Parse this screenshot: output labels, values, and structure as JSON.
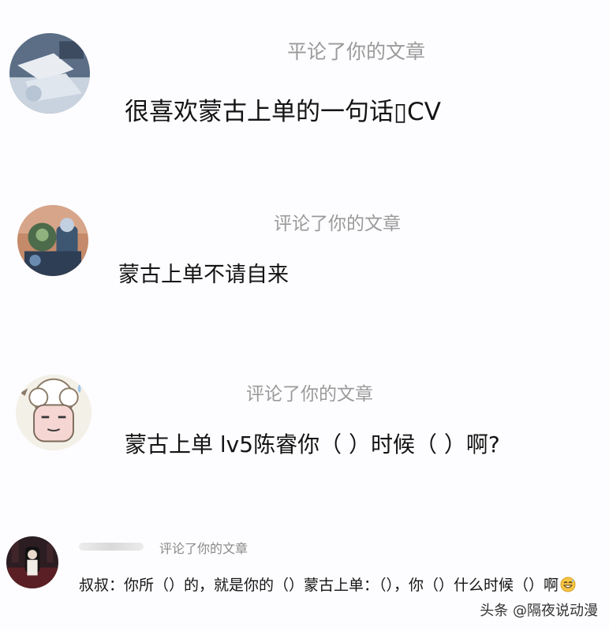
{
  "notifications": [
    {
      "action": "平论了你的文章",
      "comment": "很喜欢蒙古上单的一句话▯CV"
    },
    {
      "action": "评论了你的文章",
      "comment": "蒙古上单不请自来"
    },
    {
      "action": "评论了你的文章",
      "comment": "蒙古上单 lv5陈睿你（ ）时候（ ）啊?"
    },
    {
      "action": "评论了你的文章",
      "comment": "叔叔：你所（）的，就是你的（）蒙古上单：（），你（）什么时候（）啊"
    }
  ],
  "watermark": "头条 @隔夜说动漫",
  "icons": {
    "avatar_1": "blurry-photo-avatar",
    "avatar_2": "anime-character-avatar",
    "avatar_3": "cartoon-sheep-avatar",
    "avatar_4": "dark-figure-avatar",
    "emoji": "grinning-sweat-emoji"
  },
  "colors": {
    "background": "#fdfcfe",
    "action_text": "#9a9a9a",
    "comment_text": "#141414"
  }
}
